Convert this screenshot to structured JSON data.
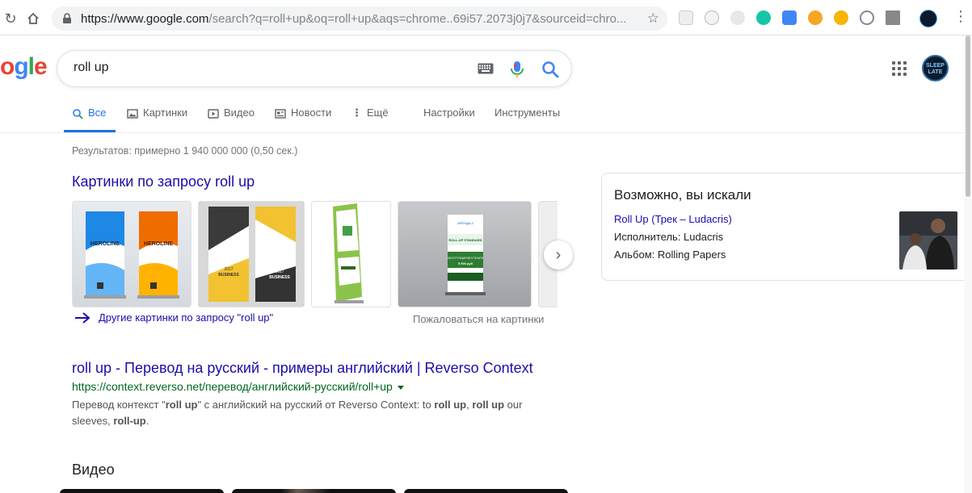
{
  "browser": {
    "url_host": "https://www.google.com",
    "url_rest": "/search?q=roll+up&oq=roll+up&aqs=chrome..69i57.2073j0j7&sourceid=chro..."
  },
  "search": {
    "logo_text": "ogle",
    "query": "roll up"
  },
  "avatar": {
    "text": "SLEEP LATE"
  },
  "tabs": {
    "all": "Все",
    "images": "Картинки",
    "video": "Видео",
    "news": "Новости",
    "more": "Ещё",
    "settings": "Настройки",
    "tools": "Инструменты"
  },
  "results": {
    "stats": "Результатов: примерно 1 940 000 000 (0,50 сек.)",
    "images_heading": "Картинки по запросу roll up",
    "more_images": "Другие картинки по запросу \"roll up\"",
    "report_images": "Пожаловаться на картинки",
    "thumb_labels": {
      "heroline": "HEROLINE",
      "business_year": "2017",
      "business": "BUSINESS",
      "rollup_standard": "ROLL-UP STANDARD",
      "arenda": "АРЕНДА-2",
      "konstr": "КОНСТРУКЦИЯ ВЕЗ ПЕЧАТИ",
      "price": "5 500 руб"
    },
    "r1": {
      "title": "roll up - Перевод на русский - примеры английский | Reverso Context",
      "url": "https://context.reverso.net/перевод/английский-русский/roll+up",
      "snippet_1": "Перевод контекст \"",
      "snippet_b1": "roll up",
      "snippet_2": "\" с английский на русский от Reverso Context: to ",
      "snippet_b2": "roll up",
      "snippet_3": ", ",
      "snippet_b3": "roll up",
      "snippet_4": " our sleeves, ",
      "snippet_b4": "roll-up",
      "snippet_5": "."
    },
    "video_heading": "Видео"
  },
  "knowledge_panel": {
    "title": "Возможно, вы искали",
    "link": "Roll Up (Трек – Ludacris)",
    "artist_label": "Исполнитель: ",
    "artist_value": "Ludacris",
    "album_label": "Альбом: ",
    "album_value": "Rolling Papers"
  },
  "colors": {
    "link": "#1a0dab",
    "url_green": "#006621",
    "active_tab": "#1a73e8"
  }
}
